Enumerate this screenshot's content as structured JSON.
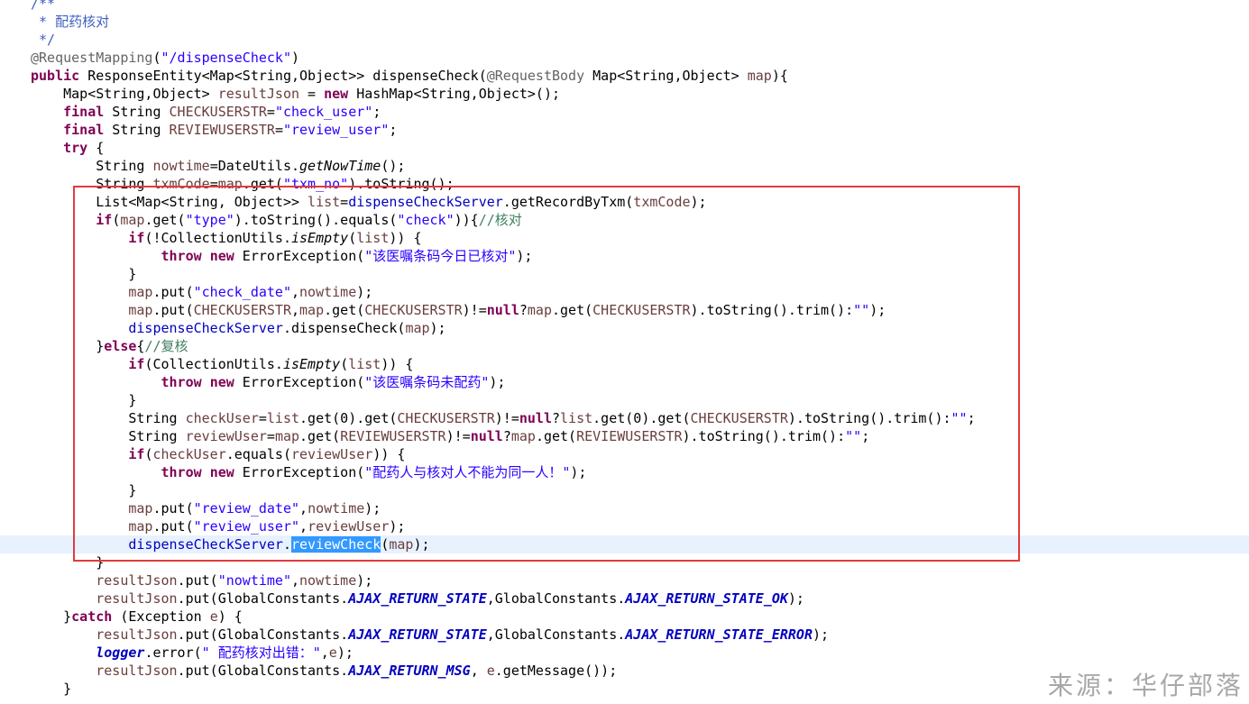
{
  "editor": {
    "language": "java",
    "highlighted_block_color": "#e03c3c",
    "selected_word": "reviewCheck",
    "lines": [
      [
        {
          "t": "/**",
          "c": "doc"
        }
      ],
      [
        {
          "t": " * 配药核对",
          "c": "doc"
        }
      ],
      [
        {
          "t": " */",
          "c": "doc"
        }
      ],
      [
        {
          "t": "@RequestMapping",
          "c": "ann"
        },
        {
          "t": "("
        },
        {
          "t": "\"/dispenseCheck\"",
          "c": "str"
        },
        {
          "t": ")"
        }
      ],
      [
        {
          "t": "public",
          "c": "kw"
        },
        {
          "t": " ResponseEntity<Map<String,Object>> dispenseCheck("
        },
        {
          "t": "@RequestBody",
          "c": "ann"
        },
        {
          "t": " Map<String,Object> "
        },
        {
          "t": "map",
          "c": "var"
        },
        {
          "t": "){"
        }
      ],
      [
        {
          "t": "    Map<String,Object> "
        },
        {
          "t": "resultJson",
          "c": "var"
        },
        {
          "t": " = "
        },
        {
          "t": "new",
          "c": "kw"
        },
        {
          "t": " HashMap<String,Object>();"
        }
      ],
      [
        {
          "t": "    "
        },
        {
          "t": "final",
          "c": "kw"
        },
        {
          "t": " String "
        },
        {
          "t": "CHECKUSERSTR",
          "c": "var"
        },
        {
          "t": "="
        },
        {
          "t": "\"check_user\"",
          "c": "str"
        },
        {
          "t": ";"
        }
      ],
      [
        {
          "t": "    "
        },
        {
          "t": "final",
          "c": "kw"
        },
        {
          "t": " String "
        },
        {
          "t": "REVIEWUSERSTR",
          "c": "var"
        },
        {
          "t": "="
        },
        {
          "t": "\"review_user\"",
          "c": "str"
        },
        {
          "t": ";"
        }
      ],
      [
        {
          "t": "    "
        },
        {
          "t": "try",
          "c": "kw"
        },
        {
          "t": " {"
        }
      ],
      [
        {
          "t": "        String "
        },
        {
          "t": "nowtime",
          "c": "var"
        },
        {
          "t": "=DateUtils."
        },
        {
          "t": "getNowTime",
          "c": "it"
        },
        {
          "t": "();"
        }
      ],
      [
        {
          "t": "        String "
        },
        {
          "t": "txmCode",
          "c": "var"
        },
        {
          "t": "="
        },
        {
          "t": "map",
          "c": "var"
        },
        {
          "t": ".get("
        },
        {
          "t": "\"txm_no\"",
          "c": "str"
        },
        {
          "t": ").toString();"
        }
      ],
      [
        {
          "t": "        List<Map<String, Object>> "
        },
        {
          "t": "list",
          "c": "var"
        },
        {
          "t": "="
        },
        {
          "t": "dispenseCheckServer",
          "c": "field"
        },
        {
          "t": ".getRecordByTxm("
        },
        {
          "t": "txmCode",
          "c": "var"
        },
        {
          "t": ");"
        }
      ],
      [
        {
          "t": "        "
        },
        {
          "t": "if",
          "c": "kw"
        },
        {
          "t": "("
        },
        {
          "t": "map",
          "c": "var"
        },
        {
          "t": ".get("
        },
        {
          "t": "\"type\"",
          "c": "str"
        },
        {
          "t": ").toString().equals("
        },
        {
          "t": "\"check\"",
          "c": "str"
        },
        {
          "t": ")){"
        },
        {
          "t": "//核对",
          "c": "com"
        }
      ],
      [
        {
          "t": "            "
        },
        {
          "t": "if",
          "c": "kw"
        },
        {
          "t": "(!CollectionUtils."
        },
        {
          "t": "isEmpty",
          "c": "it"
        },
        {
          "t": "("
        },
        {
          "t": "list",
          "c": "var"
        },
        {
          "t": ")) {"
        }
      ],
      [
        {
          "t": "                "
        },
        {
          "t": "throw",
          "c": "kw"
        },
        {
          "t": " "
        },
        {
          "t": "new",
          "c": "kw"
        },
        {
          "t": " ErrorException("
        },
        {
          "t": "\"该医嘱条码今日已核对\"",
          "c": "str"
        },
        {
          "t": ");"
        }
      ],
      [
        {
          "t": "            }"
        }
      ],
      [
        {
          "t": "            "
        },
        {
          "t": "map",
          "c": "var"
        },
        {
          "t": ".put("
        },
        {
          "t": "\"check_date\"",
          "c": "str"
        },
        {
          "t": ","
        },
        {
          "t": "nowtime",
          "c": "var"
        },
        {
          "t": ");"
        }
      ],
      [
        {
          "t": "            "
        },
        {
          "t": "map",
          "c": "var"
        },
        {
          "t": ".put("
        },
        {
          "t": "CHECKUSERSTR",
          "c": "var"
        },
        {
          "t": ","
        },
        {
          "t": "map",
          "c": "var"
        },
        {
          "t": ".get("
        },
        {
          "t": "CHECKUSERSTR",
          "c": "var"
        },
        {
          "t": ")!="
        },
        {
          "t": "null",
          "c": "kw"
        },
        {
          "t": "?"
        },
        {
          "t": "map",
          "c": "var"
        },
        {
          "t": ".get("
        },
        {
          "t": "CHECKUSERSTR",
          "c": "var"
        },
        {
          "t": ").toString().trim():"
        },
        {
          "t": "\"\"",
          "c": "str"
        },
        {
          "t": ");"
        }
      ],
      [
        {
          "t": "            "
        },
        {
          "t": "dispenseCheckServer",
          "c": "field"
        },
        {
          "t": ".dispenseCheck("
        },
        {
          "t": "map",
          "c": "var"
        },
        {
          "t": ");"
        }
      ],
      [
        {
          "t": "        }"
        },
        {
          "t": "else",
          "c": "kw"
        },
        {
          "t": "{"
        },
        {
          "t": "//复核",
          "c": "com"
        }
      ],
      [
        {
          "t": "            "
        },
        {
          "t": "if",
          "c": "kw"
        },
        {
          "t": "(CollectionUtils."
        },
        {
          "t": "isEmpty",
          "c": "it"
        },
        {
          "t": "("
        },
        {
          "t": "list",
          "c": "var"
        },
        {
          "t": ")) {"
        }
      ],
      [
        {
          "t": "                "
        },
        {
          "t": "throw",
          "c": "kw"
        },
        {
          "t": " "
        },
        {
          "t": "new",
          "c": "kw"
        },
        {
          "t": " ErrorException("
        },
        {
          "t": "\"该医嘱条码未配药\"",
          "c": "str"
        },
        {
          "t": ");"
        }
      ],
      [
        {
          "t": "            }"
        }
      ],
      [
        {
          "t": "            String "
        },
        {
          "t": "checkUser",
          "c": "var"
        },
        {
          "t": "="
        },
        {
          "t": "list",
          "c": "var"
        },
        {
          "t": ".get(0).get("
        },
        {
          "t": "CHECKUSERSTR",
          "c": "var"
        },
        {
          "t": ")!="
        },
        {
          "t": "null",
          "c": "kw"
        },
        {
          "t": "?"
        },
        {
          "t": "list",
          "c": "var"
        },
        {
          "t": ".get(0).get("
        },
        {
          "t": "CHECKUSERSTR",
          "c": "var"
        },
        {
          "t": ").toString().trim():"
        },
        {
          "t": "\"\"",
          "c": "str"
        },
        {
          "t": ";"
        }
      ],
      [
        {
          "t": "            String "
        },
        {
          "t": "reviewUser",
          "c": "var"
        },
        {
          "t": "="
        },
        {
          "t": "map",
          "c": "var"
        },
        {
          "t": ".get("
        },
        {
          "t": "REVIEWUSERSTR",
          "c": "var"
        },
        {
          "t": ")!="
        },
        {
          "t": "null",
          "c": "kw"
        },
        {
          "t": "?"
        },
        {
          "t": "map",
          "c": "var"
        },
        {
          "t": ".get("
        },
        {
          "t": "REVIEWUSERSTR",
          "c": "var"
        },
        {
          "t": ").toString().trim():"
        },
        {
          "t": "\"\"",
          "c": "str"
        },
        {
          "t": ";"
        }
      ],
      [
        {
          "t": "            "
        },
        {
          "t": "if",
          "c": "kw"
        },
        {
          "t": "("
        },
        {
          "t": "checkUser",
          "c": "var"
        },
        {
          "t": ".equals("
        },
        {
          "t": "reviewUser",
          "c": "var"
        },
        {
          "t": ")) {"
        }
      ],
      [
        {
          "t": "                "
        },
        {
          "t": "throw",
          "c": "kw"
        },
        {
          "t": " "
        },
        {
          "t": "new",
          "c": "kw"
        },
        {
          "t": " ErrorException("
        },
        {
          "t": "\"配药人与核对人不能为同一人！\"",
          "c": "str"
        },
        {
          "t": ");"
        }
      ],
      [
        {
          "t": "            }"
        }
      ],
      [
        {
          "t": "            "
        },
        {
          "t": "map",
          "c": "var"
        },
        {
          "t": ".put("
        },
        {
          "t": "\"review_date\"",
          "c": "str"
        },
        {
          "t": ","
        },
        {
          "t": "nowtime",
          "c": "var"
        },
        {
          "t": ");"
        }
      ],
      [
        {
          "t": "            "
        },
        {
          "t": "map",
          "c": "var"
        },
        {
          "t": ".put("
        },
        {
          "t": "\"review_user\"",
          "c": "str"
        },
        {
          "t": ","
        },
        {
          "t": "reviewUser",
          "c": "var"
        },
        {
          "t": ");"
        }
      ],
      [
        {
          "t": "            "
        },
        {
          "t": "dispenseCheckServer",
          "c": "field"
        },
        {
          "t": "."
        },
        {
          "t": "reviewCheck",
          "c": "sel"
        },
        {
          "t": "("
        },
        {
          "t": "map",
          "c": "var"
        },
        {
          "t": ");"
        }
      ],
      [
        {
          "t": "        }"
        }
      ],
      [
        {
          "t": "        "
        },
        {
          "t": "resultJson",
          "c": "var"
        },
        {
          "t": ".put("
        },
        {
          "t": "\"nowtime\"",
          "c": "str"
        },
        {
          "t": ","
        },
        {
          "t": "nowtime",
          "c": "var"
        },
        {
          "t": ");"
        }
      ],
      [
        {
          "t": "        "
        },
        {
          "t": "resultJson",
          "c": "var"
        },
        {
          "t": ".put(GlobalConstants."
        },
        {
          "t": "AJAX_RETURN_STATE",
          "c": "static"
        },
        {
          "t": ",GlobalConstants."
        },
        {
          "t": "AJAX_RETURN_STATE_OK",
          "c": "static"
        },
        {
          "t": ");"
        }
      ],
      [
        {
          "t": "    }"
        },
        {
          "t": "catch",
          "c": "kw"
        },
        {
          "t": " (Exception "
        },
        {
          "t": "e",
          "c": "var"
        },
        {
          "t": ") {"
        }
      ],
      [
        {
          "t": "        "
        },
        {
          "t": "resultJson",
          "c": "var"
        },
        {
          "t": ".put(GlobalConstants."
        },
        {
          "t": "AJAX_RETURN_STATE",
          "c": "static"
        },
        {
          "t": ",GlobalConstants."
        },
        {
          "t": "AJAX_RETURN_STATE_ERROR",
          "c": "static"
        },
        {
          "t": ");"
        }
      ],
      [
        {
          "t": "        "
        },
        {
          "t": "logger",
          "c": "static"
        },
        {
          "t": ".error("
        },
        {
          "t": "\" 配药核对出错：\"",
          "c": "str"
        },
        {
          "t": ","
        },
        {
          "t": "e",
          "c": "var"
        },
        {
          "t": ");"
        }
      ],
      [
        {
          "t": "        "
        },
        {
          "t": "resultJson",
          "c": "var"
        },
        {
          "t": ".put(GlobalConstants."
        },
        {
          "t": "AJAX_RETURN_MSG",
          "c": "static"
        },
        {
          "t": ", "
        },
        {
          "t": "e",
          "c": "var"
        },
        {
          "t": ".getMessage());"
        }
      ],
      [
        {
          "t": "    }"
        }
      ]
    ]
  },
  "watermark": {
    "text": "来源：华仔部落"
  }
}
